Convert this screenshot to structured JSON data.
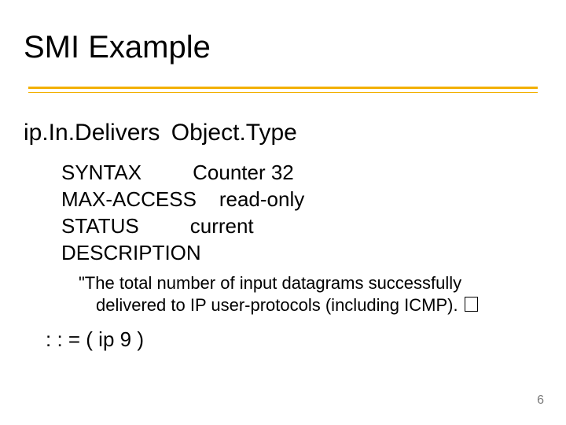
{
  "title": "SMI Example",
  "object": {
    "identifier": "ip.In.Delivers",
    "object_type_label": "Object.Type"
  },
  "fields": {
    "syntax_key": "SYNTAX",
    "syntax_val": "Counter 32",
    "max_access_key": "MAX-ACCESS",
    "max_access_val": "read-only",
    "status_key": "STATUS",
    "status_val": "current",
    "description_key": "DESCRIPTION"
  },
  "description": {
    "line1": "\"The total number of input datagrams successfully",
    "line2": "delivered to IP user-protocols (including ICMP). "
  },
  "oid_line": ": : = ( ip 9 )",
  "page_number": "6"
}
